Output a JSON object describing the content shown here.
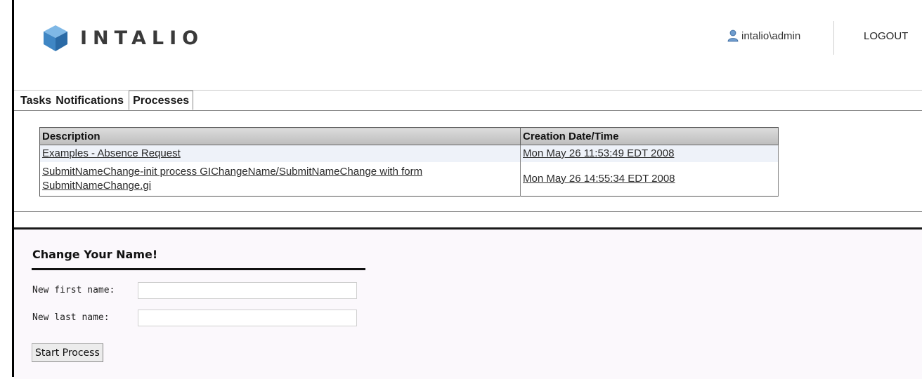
{
  "header": {
    "logo_text": "INTALIO",
    "user_label": "intalio\\admin",
    "logout_label": "LOGOUT",
    "user_icon": "user-icon",
    "brand_color": "#4a8fc7"
  },
  "tabs": [
    {
      "label": "Tasks",
      "active": false
    },
    {
      "label": "Notifications",
      "active": false
    },
    {
      "label": "Processes",
      "active": true
    }
  ],
  "processes": {
    "columns": [
      "Description",
      "Creation Date/Time"
    ],
    "rows": [
      {
        "description": "Examples - Absence Request",
        "created": "Mon May 26 11:53:49 EDT 2008"
      },
      {
        "description": "SubmitNameChange-init process GIChangeName/SubmitNameChange with form SubmitNameChange.gi",
        "created": "Mon May 26 14:55:34 EDT 2008"
      }
    ]
  },
  "form": {
    "title": "Change Your Name!",
    "first_name_label": "New first name:",
    "first_name_value": "",
    "last_name_label": "New last name:",
    "last_name_value": "",
    "submit_label": "Start Process"
  }
}
